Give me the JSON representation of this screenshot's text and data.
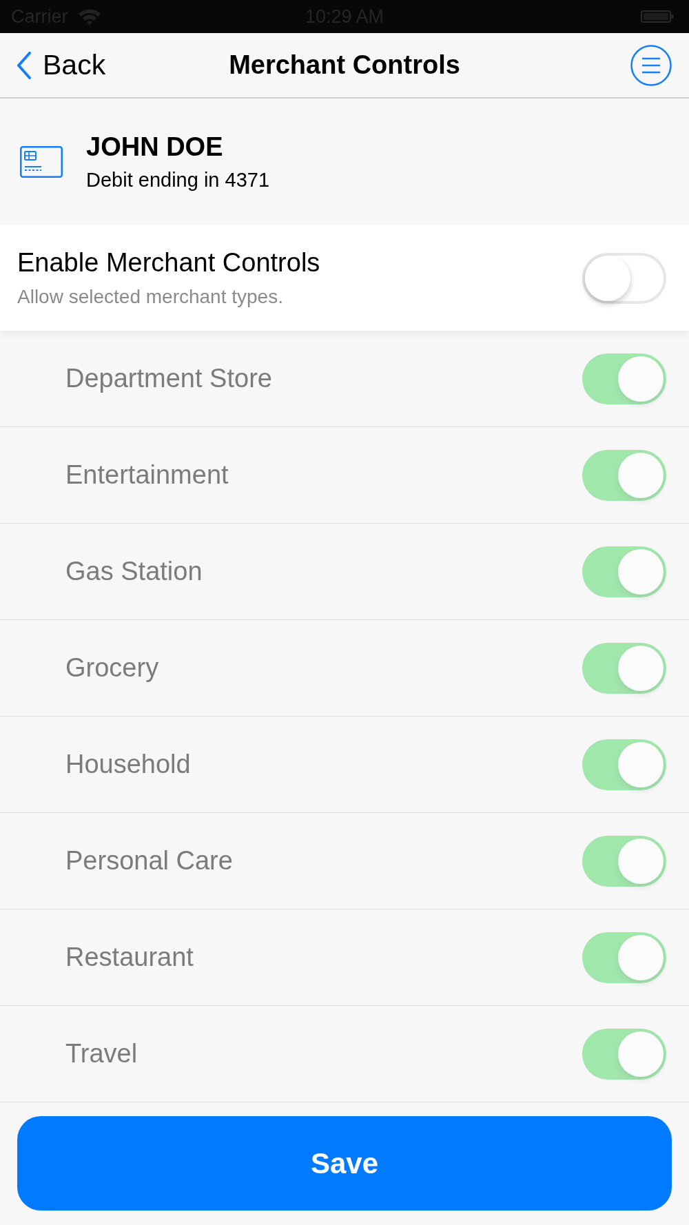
{
  "status_bar": {
    "carrier": "Carrier",
    "time": "10:29 AM"
  },
  "nav_bar": {
    "back_label": "Back",
    "title": "Merchant Controls"
  },
  "card": {
    "holder": "JOHN DOE",
    "description": "Debit ending in 4371"
  },
  "master_switch": {
    "label": "Enable Merchant Controls",
    "hint": "Allow selected merchant types.",
    "on": false
  },
  "merchant_types": [
    {
      "label": "Department Store",
      "on": true
    },
    {
      "label": "Entertainment",
      "on": true
    },
    {
      "label": "Gas Station",
      "on": true
    },
    {
      "label": "Grocery",
      "on": true
    },
    {
      "label": "Household",
      "on": true
    },
    {
      "label": "Personal Care",
      "on": true
    },
    {
      "label": "Restaurant",
      "on": true
    },
    {
      "label": "Travel",
      "on": true
    }
  ],
  "save_button": {
    "label": "Save"
  }
}
